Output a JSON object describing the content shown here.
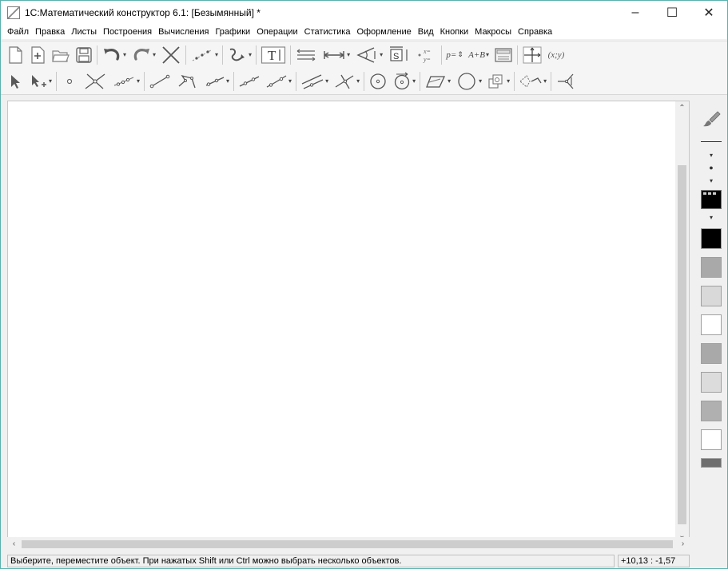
{
  "window": {
    "title": "1С:Математический конструктор 6.1: [Безымянный] *",
    "minimize": "–",
    "maximize": "☐",
    "close": "✕"
  },
  "menu": [
    "Файл",
    "Правка",
    "Листы",
    "Построения",
    "Вычисления",
    "Графики",
    "Операции",
    "Статистика",
    "Оформление",
    "Вид",
    "Кнопки",
    "Макросы",
    "Справка"
  ],
  "toolbar1": {
    "text_tool": "T",
    "snap_label": "S",
    "params_label": "p=",
    "formula_label": "A+B",
    "coords_label": "(x;y)"
  },
  "statusbar": {
    "message": "Выберите, переместите объект. При нажатых Shift или Ctrl можно выбрать несколько объектов.",
    "coords": "+10,13 : -1,57"
  },
  "colors": {
    "accent_border": "#5ab2ae",
    "swatches": [
      "#000000",
      "#000000",
      "#a9a9a9",
      "#d9d9d9",
      "#ffffff",
      "#a9a9a9",
      "#d9d9d9",
      "#b0b0b0",
      "#ffffff"
    ]
  }
}
